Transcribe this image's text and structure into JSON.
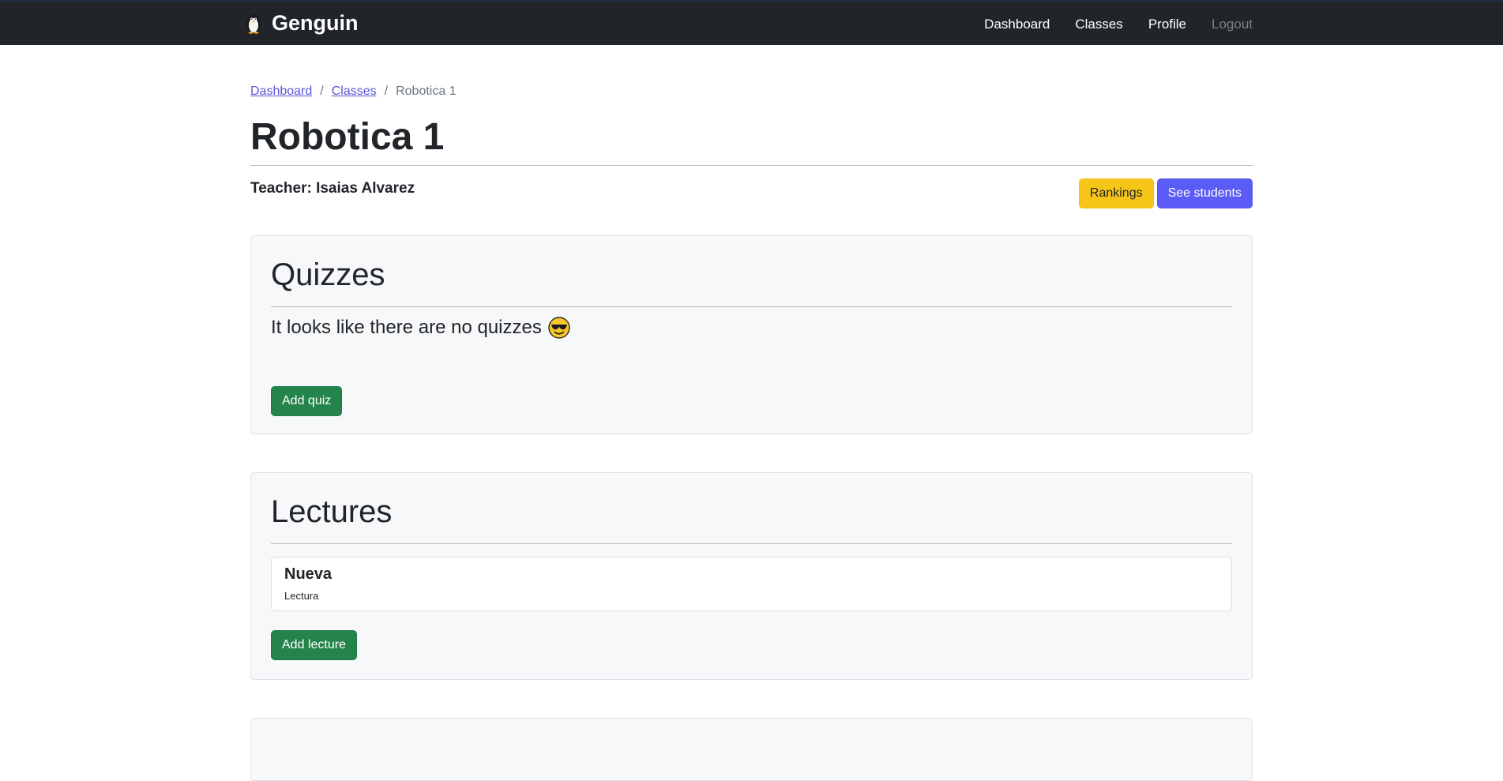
{
  "navbar": {
    "brand": "Genguin",
    "links": [
      {
        "label": "Dashboard"
      },
      {
        "label": "Classes"
      },
      {
        "label": "Profile"
      },
      {
        "label": "Logout"
      }
    ]
  },
  "breadcrumb": {
    "items": [
      "Dashboard",
      "Classes"
    ],
    "separator": "/",
    "current": "Robotica 1"
  },
  "page": {
    "title": "Robotica 1",
    "teacher": "Teacher: Isaias Alvarez"
  },
  "actions": {
    "rankings_label": "Rankings",
    "see_students_label": "See students"
  },
  "quizzes": {
    "heading": "Quizzes",
    "empty_message": "It looks like there are no quizzes",
    "empty_icon": "smiling-face-with-sunglasses-icon",
    "add_label": "Add quiz"
  },
  "lectures": {
    "heading": "Lectures",
    "items": [
      {
        "title": "Nueva",
        "subtitle": "Lectura"
      }
    ],
    "add_label": "Add lecture"
  },
  "colors": {
    "navbar_bg": "#212529",
    "link": "#5a55d6",
    "warning": "#f5c518",
    "primary": "#5b5bf5",
    "success": "#24844b",
    "card_bg": "#f7f8f9"
  }
}
